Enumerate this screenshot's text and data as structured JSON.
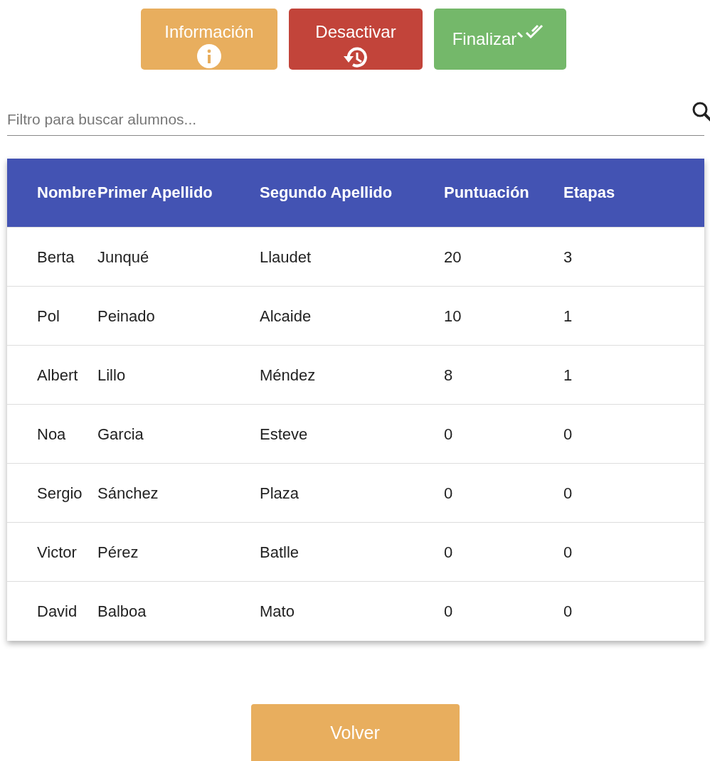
{
  "actions": [
    {
      "label": "Información",
      "kind": "info"
    },
    {
      "label": "Desactivar",
      "kind": "deactivate"
    },
    {
      "label": "Finalizar",
      "kind": "finish"
    }
  ],
  "search": {
    "placeholder": "Filtro para buscar alumnos..."
  },
  "table": {
    "columns": [
      "Nombre",
      "Primer Apellido",
      "Segundo Apellido",
      "Puntuación",
      "Etapas"
    ],
    "rows": [
      [
        "Berta",
        "Junqué",
        "Llaudet",
        "20",
        "3"
      ],
      [
        "Pol",
        "Peinado",
        "Alcaide",
        "10",
        "1"
      ],
      [
        "Albert",
        "Lillo",
        "Méndez",
        "8",
        "1"
      ],
      [
        "Noa",
        "Garcia",
        "Esteve",
        "0",
        "0"
      ],
      [
        "Sergio",
        "Sánchez",
        "Plaza",
        "0",
        "0"
      ],
      [
        "Victor",
        "Pérez",
        "Batlle",
        "0",
        "0"
      ],
      [
        "David",
        "Balboa",
        "Mato",
        "0",
        "0"
      ]
    ]
  },
  "back_button": {
    "label": "Volver"
  }
}
